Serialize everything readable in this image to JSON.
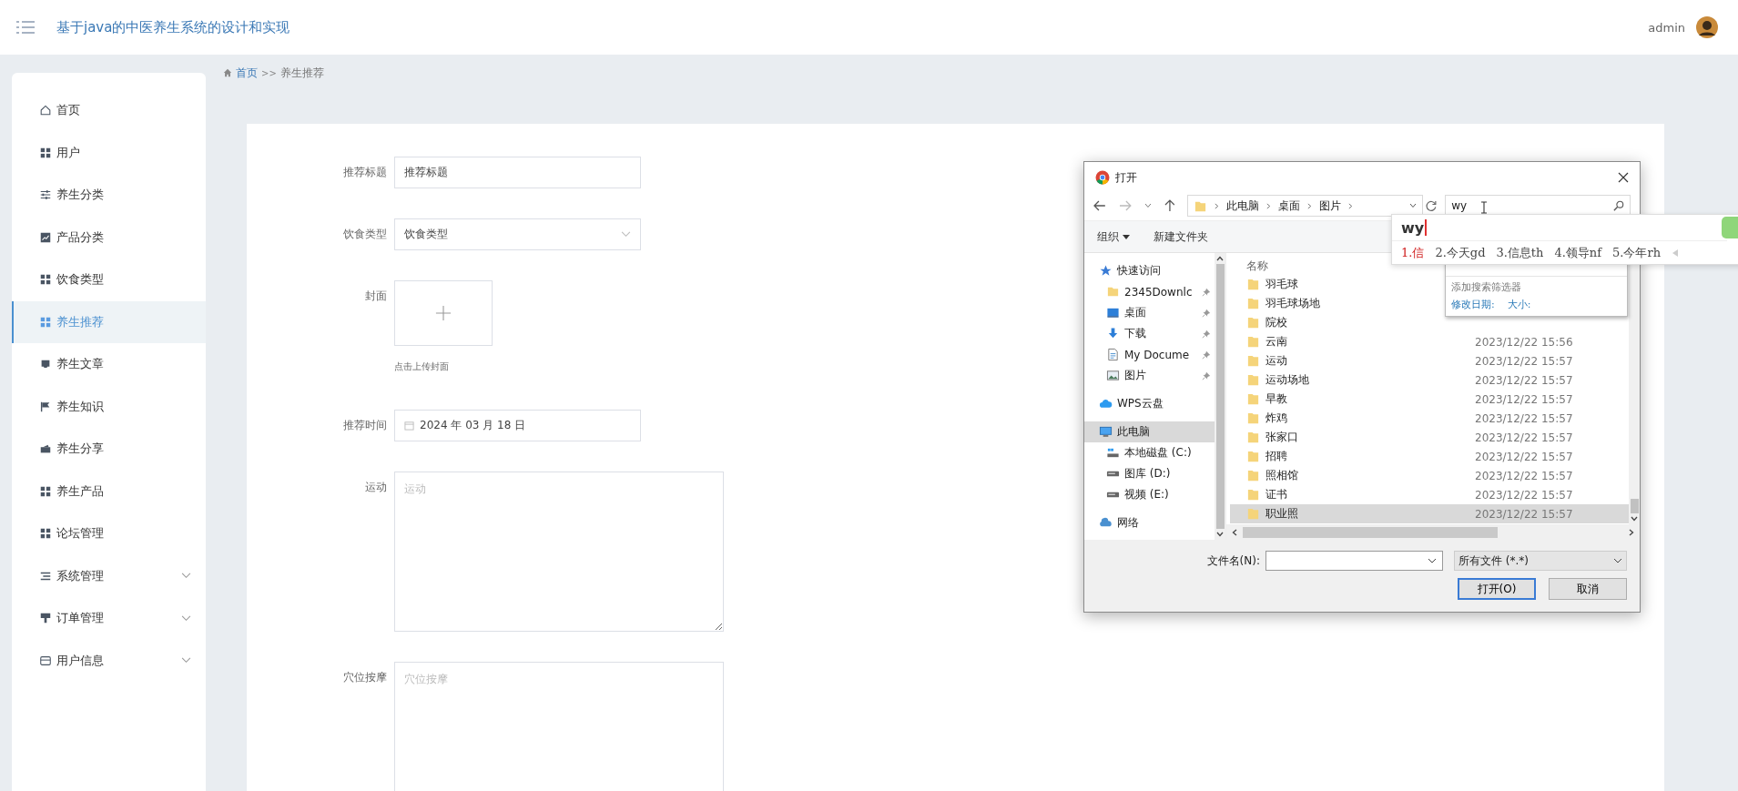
{
  "header": {
    "title": "基于java的中医养生系统的设计和实现",
    "user": "admin"
  },
  "sidebar": {
    "items": [
      {
        "label": "首页",
        "selected": false,
        "submenu": false
      },
      {
        "label": "用户",
        "selected": false,
        "submenu": false
      },
      {
        "label": "养生分类",
        "selected": false,
        "submenu": false
      },
      {
        "label": "产品分类",
        "selected": false,
        "submenu": false
      },
      {
        "label": "饮食类型",
        "selected": false,
        "submenu": false
      },
      {
        "label": "养生推荐",
        "selected": true,
        "submenu": false
      },
      {
        "label": "养生文章",
        "selected": false,
        "submenu": false
      },
      {
        "label": "养生知识",
        "selected": false,
        "submenu": false
      },
      {
        "label": "养生分享",
        "selected": false,
        "submenu": false
      },
      {
        "label": "养生产品",
        "selected": false,
        "submenu": false
      },
      {
        "label": "论坛管理",
        "selected": false,
        "submenu": false
      },
      {
        "label": "系统管理",
        "selected": false,
        "submenu": true
      },
      {
        "label": "订单管理",
        "selected": false,
        "submenu": true
      },
      {
        "label": "用户信息",
        "selected": false,
        "submenu": true
      }
    ]
  },
  "breadcrumb": {
    "home": "首页",
    "separator": ">>",
    "current": "养生推荐"
  },
  "form": {
    "fields": [
      {
        "kind": "text",
        "label": "推荐标题",
        "value": "推荐标题"
      },
      {
        "kind": "select",
        "label": "饮食类型",
        "value": "饮食类型"
      },
      {
        "kind": "upload",
        "label": "封面",
        "hint": "点击上传封面"
      },
      {
        "kind": "date",
        "label": "推荐时间",
        "value": "2024 年 03 月 18 日"
      },
      {
        "kind": "textarea",
        "label": "运动",
        "placeholder": "运动"
      },
      {
        "kind": "textarea",
        "label": "穴位按摩",
        "placeholder": "穴位按摩"
      }
    ]
  },
  "dialog": {
    "title": "打开",
    "path": [
      "此电脑",
      "桌面",
      "图片"
    ],
    "search": {
      "value": "wy"
    },
    "toolbar": [
      "组织",
      "新建文件夹"
    ],
    "nav": [
      {
        "label": "快速访问",
        "selected": false,
        "pinned": false,
        "children": [
          {
            "label": "2345Downlc",
            "selected": false,
            "pinned": true
          },
          {
            "label": "桌面",
            "selected": false,
            "pinned": true
          },
          {
            "label": "下载",
            "selected": false,
            "pinned": true
          },
          {
            "label": "My Docume",
            "selected": false,
            "pinned": true
          },
          {
            "label": "图片",
            "selected": false,
            "pinned": true
          }
        ]
      },
      {
        "label": "WPS云盘",
        "selected": false,
        "pinned": false
      },
      {
        "label": "此电脑",
        "selected": true,
        "pinned": false,
        "children": [
          {
            "label": "本地磁盘 (C:)",
            "selected": false,
            "pinned": false
          },
          {
            "label": "图库 (D:)",
            "selected": false,
            "pinned": false
          },
          {
            "label": "视频 (E:)",
            "selected": false,
            "pinned": false
          }
        ]
      },
      {
        "label": "网络",
        "selected": false,
        "pinned": false
      }
    ],
    "files": {
      "column": "名称",
      "rows": [
        {
          "name": "羽毛球",
          "selected": false
        },
        {
          "name": "羽毛球场地",
          "selected": false
        },
        {
          "name": "院校",
          "selected": false
        },
        {
          "name": "云南",
          "date": "2023/12/22 15:56",
          "selected": false
        },
        {
          "name": "运动",
          "date": "2023/12/22 15:57",
          "selected": false
        },
        {
          "name": "运动场地",
          "date": "2023/12/22 15:57",
          "selected": false
        },
        {
          "name": "早教",
          "date": "2023/12/22 15:57",
          "selected": false
        },
        {
          "name": "炸鸡",
          "date": "2023/12/22 15:57",
          "selected": false
        },
        {
          "name": "张家口",
          "date": "2023/12/22 15:57",
          "selected": false
        },
        {
          "name": "招聘",
          "date": "2023/12/22 15:57",
          "selected": false
        },
        {
          "name": "照相馆",
          "date": "2023/12/22 15:57",
          "selected": false
        },
        {
          "name": "证书",
          "date": "2023/12/22 15:57",
          "selected": false
        },
        {
          "name": "职业照",
          "date": "2023/12/22 15:57",
          "selected": true
        }
      ]
    },
    "filename_label": "文件名(N):",
    "filetype": "所有文件 (*.*)",
    "buttons": [
      "打开(O)",
      "取消"
    ],
    "search_popup": {
      "add_filter": "添加搜索筛选器",
      "filters": [
        "修改日期:",
        "大小:"
      ]
    }
  },
  "ime": {
    "input": "wy",
    "candidates": [
      {
        "text": "1.信",
        "selected": true
      },
      {
        "text": "2.今天gd",
        "selected": false
      },
      {
        "text": "3.信息th",
        "selected": false
      },
      {
        "text": "4.领导nf",
        "selected": false
      },
      {
        "text": "5.今年rh",
        "selected": false
      }
    ]
  }
}
